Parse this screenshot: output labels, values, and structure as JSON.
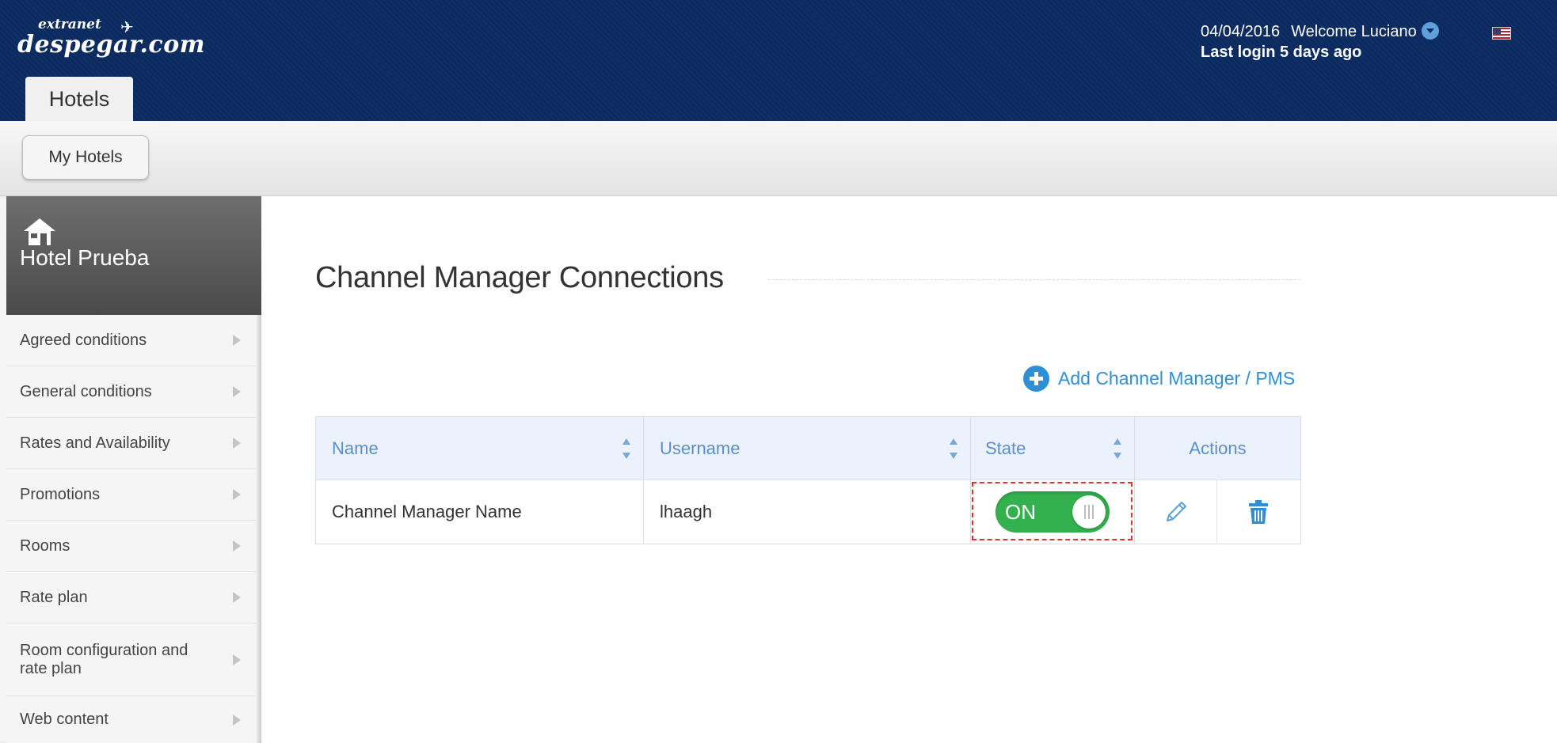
{
  "header": {
    "logo_small": "extranet",
    "logo_big": "despegar.com",
    "tab_label": "Hotels",
    "date": "04/04/2016",
    "welcome": "Welcome Luciano",
    "last_login": "Last login 5 days ago"
  },
  "subbar": {
    "my_hotels_label": "My Hotels"
  },
  "sidebar": {
    "hotel_name": "Hotel Prueba",
    "items": [
      {
        "label": "Agreed conditions"
      },
      {
        "label": "General conditions"
      },
      {
        "label": "Rates and Availability"
      },
      {
        "label": "Promotions"
      },
      {
        "label": "Rooms"
      },
      {
        "label": "Rate plan"
      },
      {
        "label": "Room configuration and rate plan"
      },
      {
        "label": "Web content"
      }
    ]
  },
  "main": {
    "title": "Channel Manager Connections",
    "add_label": "Add Channel Manager / PMS",
    "table": {
      "headers": {
        "name": "Name",
        "username": "Username",
        "state": "State",
        "actions": "Actions"
      },
      "rows": [
        {
          "name": "Channel Manager Name",
          "username": "lhaagh",
          "state": "ON"
        }
      ]
    }
  },
  "icons": {
    "header": [
      "plane-icon",
      "user-dropdown-icon",
      "us-flag-icon"
    ],
    "sidebar": [
      "house-icon",
      "chevron-right-icon"
    ],
    "main": [
      "plus-circle-icon",
      "sort-icon",
      "pencil-icon",
      "trash-icon"
    ]
  },
  "colors": {
    "header_bg": "#0b2a5f",
    "link_blue": "#2f8fd6",
    "table_header_text": "#5b8fcb",
    "toggle_on": "#34b14f",
    "highlight": "#dd3333"
  }
}
